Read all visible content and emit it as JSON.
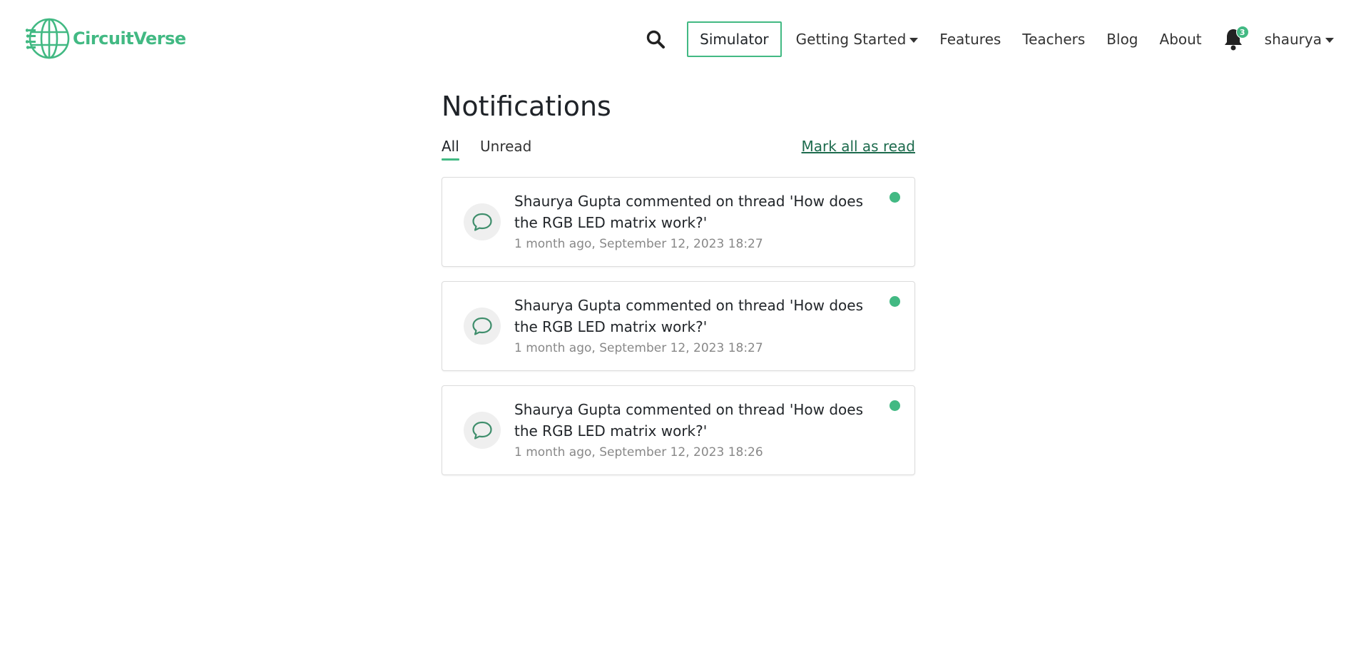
{
  "brand": {
    "name": "CircuitVerse",
    "color": "#42b983"
  },
  "nav": {
    "search_icon": "search-icon",
    "simulator_label": "Simulator",
    "getting_started_label": "Getting Started",
    "features_label": "Features",
    "teachers_label": "Teachers",
    "blog_label": "Blog",
    "about_label": "About",
    "notifications_count": "3",
    "user_label": "shaurya"
  },
  "page": {
    "title": "Notifications",
    "tabs": [
      {
        "label": "All",
        "active": true
      },
      {
        "label": "Unread",
        "active": false
      }
    ],
    "mark_all_label": "Mark all as read"
  },
  "notifications": [
    {
      "text": "Shaurya Gupta commented on thread 'How does the RGB LED matrix work?'",
      "time": "1 month ago, September 12, 2023 18:27",
      "unread": true,
      "icon": "comment-icon"
    },
    {
      "text": "Shaurya Gupta commented on thread 'How does the RGB LED matrix work?'",
      "time": "1 month ago, September 12, 2023 18:27",
      "unread": true,
      "icon": "comment-icon"
    },
    {
      "text": "Shaurya Gupta commented on thread 'How does the RGB LED matrix work?'",
      "time": "1 month ago, September 12, 2023 18:26",
      "unread": true,
      "icon": "comment-icon"
    }
  ],
  "colors": {
    "accent": "#42b983",
    "link": "#1d6b4d",
    "muted": "#888888"
  }
}
